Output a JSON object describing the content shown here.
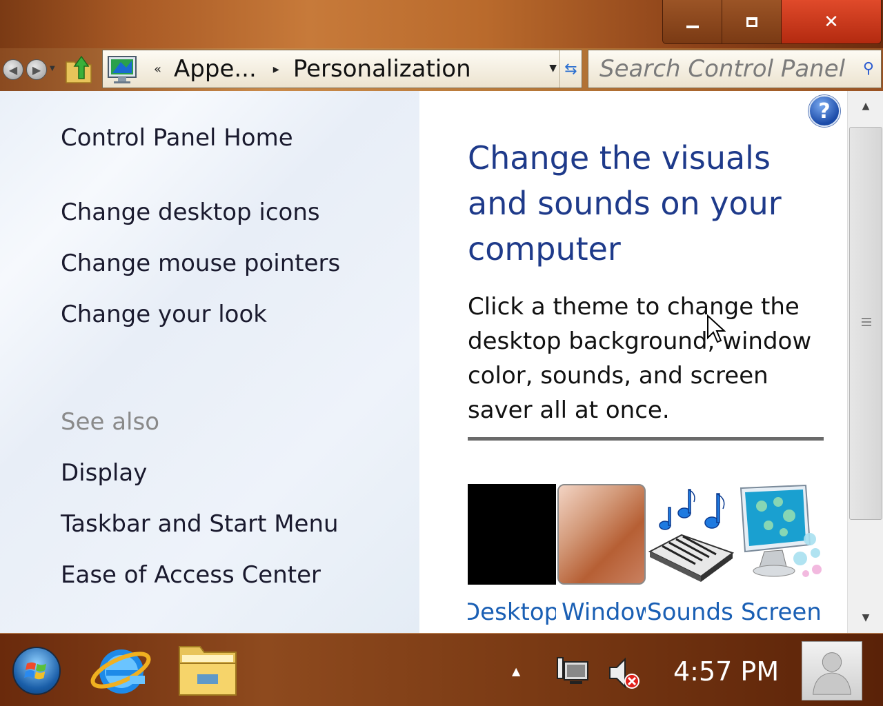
{
  "window_controls": {
    "minimize": "minimize",
    "maximize": "maximize",
    "close": "✕"
  },
  "address_bar": {
    "overflow_glyph": "«",
    "segments": [
      "Appe...",
      "Personalization"
    ],
    "separator": "▸"
  },
  "search": {
    "placeholder": "Search Control Panel"
  },
  "left_nav": {
    "home": "Control Panel Home",
    "tasks": [
      "Change desktop icons",
      "Change mouse pointers",
      "Change your look"
    ],
    "see_also_heading": "See also",
    "see_also": [
      "Display",
      "Taskbar and Start Menu",
      "Ease of Access Center"
    ]
  },
  "main": {
    "heading": "Change the visuals and sounds on your computer",
    "description": "Click a theme to change the desktop background, window color, sounds, and screen saver all at once.",
    "thumbnails": [
      {
        "label": "Desktop",
        "icon": "desktop-background-icon"
      },
      {
        "label": "Window",
        "icon": "window-color-icon"
      },
      {
        "label": "Sounds",
        "icon": "sounds-icon"
      },
      {
        "label": "Screen",
        "icon": "screen-saver-icon"
      }
    ]
  },
  "help": {
    "glyph": "?"
  },
  "taskbar": {
    "clock": "4:57 PM",
    "tray_arrow": "▲"
  },
  "colors": {
    "heading": "#1e3a8a",
    "link": "#1a5fb4",
    "accent_close": "#c9341a"
  }
}
